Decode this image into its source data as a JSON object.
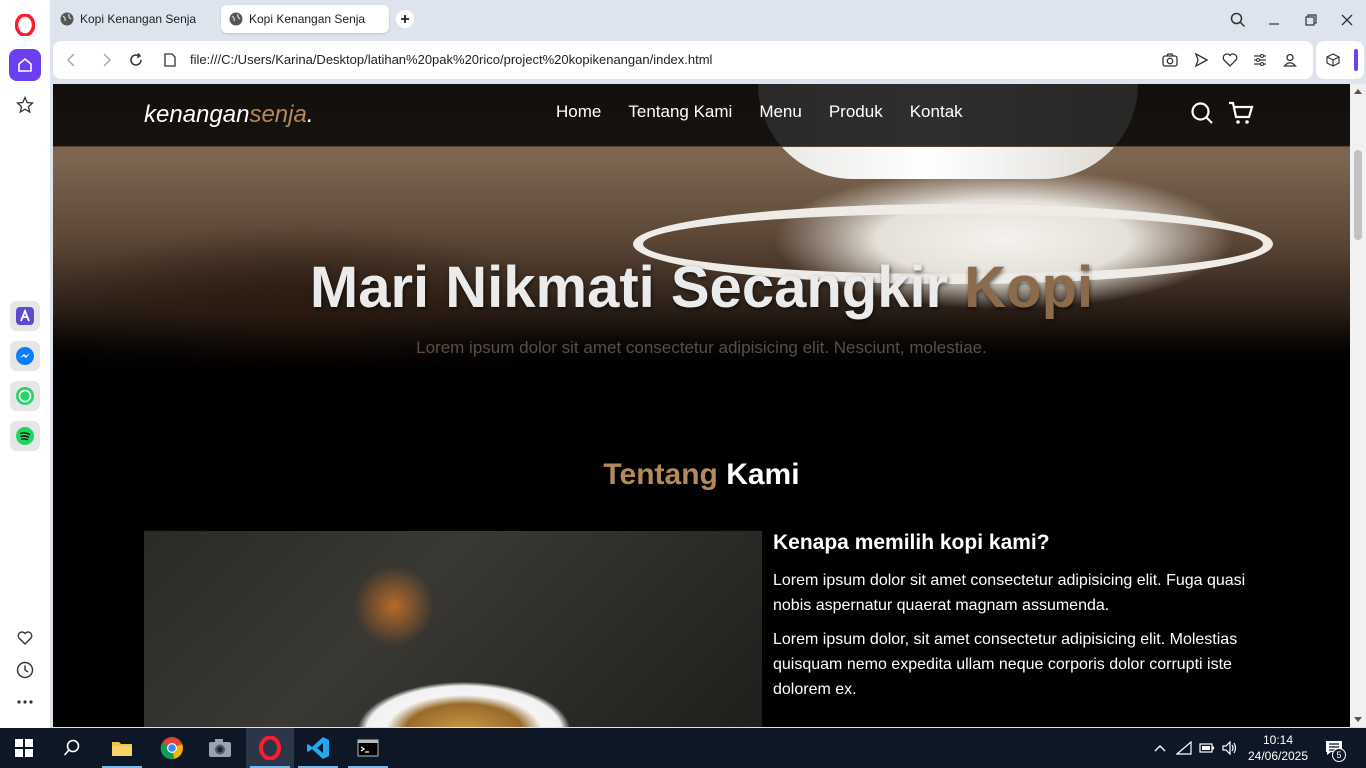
{
  "browser": {
    "tabs": [
      {
        "title": "Kopi Kenangan Senja",
        "active": false
      },
      {
        "title": "Kopi Kenangan Senja",
        "active": true
      }
    ],
    "url": "file:///C:/Users/Karina/Desktop/latihan%20pak%20rico/project%20kopikenangan/index.html"
  },
  "page": {
    "logo": {
      "main": "kenangan",
      "accent": "senja",
      "dot": "."
    },
    "nav": [
      "Home",
      "Tentang Kami",
      "Menu",
      "Produk",
      "Kontak"
    ],
    "hero": {
      "title_main": "Mari Nikmati Secangkir ",
      "title_accent": "Kopi",
      "subtitle": "Lorem ipsum dolor sit amet consectetur adipisicing elit. Nesciunt, molestiae."
    },
    "about": {
      "title_accent": "Tentang",
      "title_main": " Kami",
      "heading": "Kenapa memilih kopi kami?",
      "paragraphs": [
        "Lorem ipsum dolor sit amet consectetur adipisicing elit. Fuga quasi nobis aspernatur quaerat magnam assumenda.",
        "Lorem ipsum dolor, sit amet consectetur adipisicing elit. Molestias quisquam nemo expedita ullam neque corporis dolor corrupti iste dolorem ex."
      ]
    },
    "colors": {
      "accent": "#b6895b",
      "background": "#000000"
    }
  },
  "taskbar": {
    "time": "10:14",
    "date": "24/06/2025",
    "notifications": "5"
  }
}
